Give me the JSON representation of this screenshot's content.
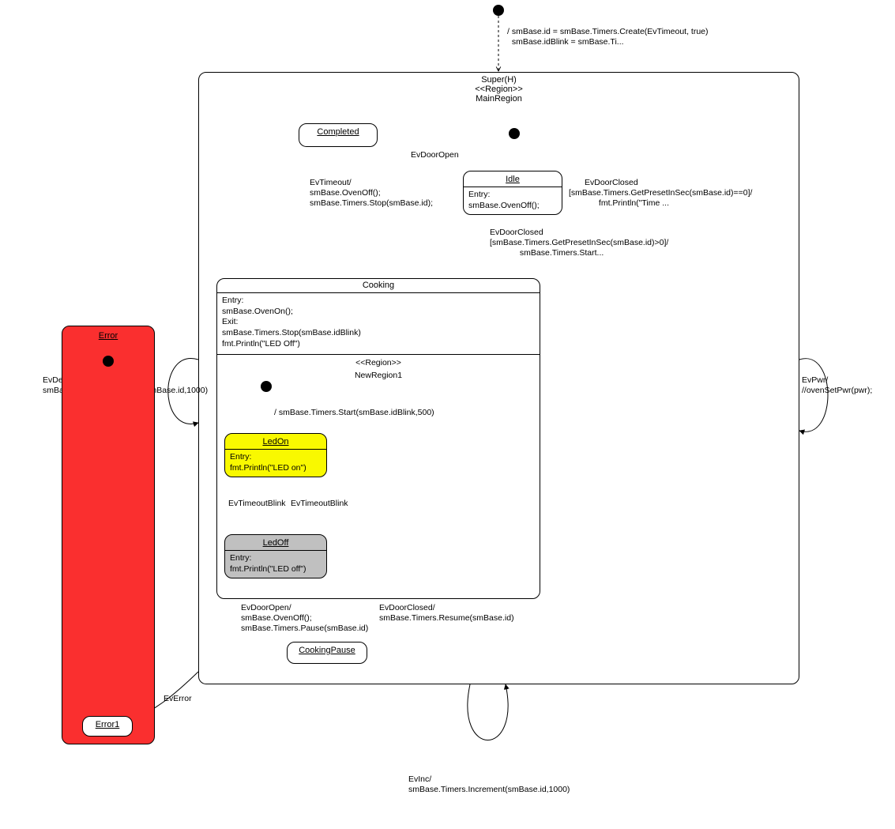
{
  "topInit": {
    "action": "/ smBase.id = smBase.Timers.Create(EvTimeout, true)\n  smBase.idBlink = smBase.Ti..."
  },
  "super": {
    "title": "Super(H)",
    "regionStereo": "<<Region>>",
    "regionName": "MainRegion"
  },
  "completed": {
    "name": "Completed"
  },
  "idle": {
    "name": "Idle",
    "entryLabel": "Entry:",
    "entryAction": "smBase.OvenOff();"
  },
  "idleSelf": {
    "event": "EvDoorClosed",
    "guardAction": "[smBase.Timers.GetPresetInSec(smBase.id)==0]/\n             fmt.Println(\"Time ..."
  },
  "idleToCooking": {
    "event": "EvDoorClosed",
    "guardAction": "[smBase.Timers.GetPresetInSec(smBase.id)>0]/\n             smBase.Timers.Start..."
  },
  "completedToIdle": {
    "event": "EvDoorOpen"
  },
  "cookingToCompleted": {
    "event": "EvTimeout/",
    "action": "smBase.OvenOff();\nsmBase.Timers.Stop(smBase.id);"
  },
  "cooking": {
    "name": "Cooking",
    "entryLabel": "Entry:",
    "entryAction": "smBase.OvenOn();",
    "exitLabel": "Exit:",
    "exitAction1": "smBase.Timers.Stop(smBase.idBlink)",
    "exitAction2": "fmt.Println(\"LED Off\")",
    "regionStereo": "<<Region>>",
    "regionName": "NewRegion1"
  },
  "cookingInit": {
    "action": "/ smBase.Timers.Start(smBase.idBlink,500)"
  },
  "ledOn": {
    "name": "LedOn",
    "entryLabel": "Entry:",
    "entryAction": "fmt.Println(\"LED on\")"
  },
  "ledOff": {
    "name": "LedOff",
    "entryLabel": "Entry:",
    "entryAction": "fmt.Println(\"LED off\")"
  },
  "ledTransitions": {
    "toOff": "EvTimeoutBlink",
    "toOn": "EvTimeoutBlink"
  },
  "cookingPause": {
    "name": "CookingPause"
  },
  "cookingToPause": {
    "event": "EvDoorOpen/",
    "action": "smBase.OvenOff();\nsmBase.Timers.Pause(smBase.id)"
  },
  "pauseToCooking": {
    "event": "EvDoorClosed/",
    "action": "smBase.Timers.Resume(smBase.id)"
  },
  "superSelf": {
    "evInc": {
      "label": "EvInc/\nsmBase.Timers.Increment(smBase.id,1000)"
    },
    "evDec": {
      "label": "EvDec/\nsmBase.Timers.Decrement(smBase.id,1000)"
    },
    "evPwr": {
      "label": "EvPwr/\n//ovenSetPwr(pwr);"
    }
  },
  "error": {
    "name": "Error",
    "error1": "Error1"
  },
  "superToError1": {
    "event": "EvError"
  }
}
